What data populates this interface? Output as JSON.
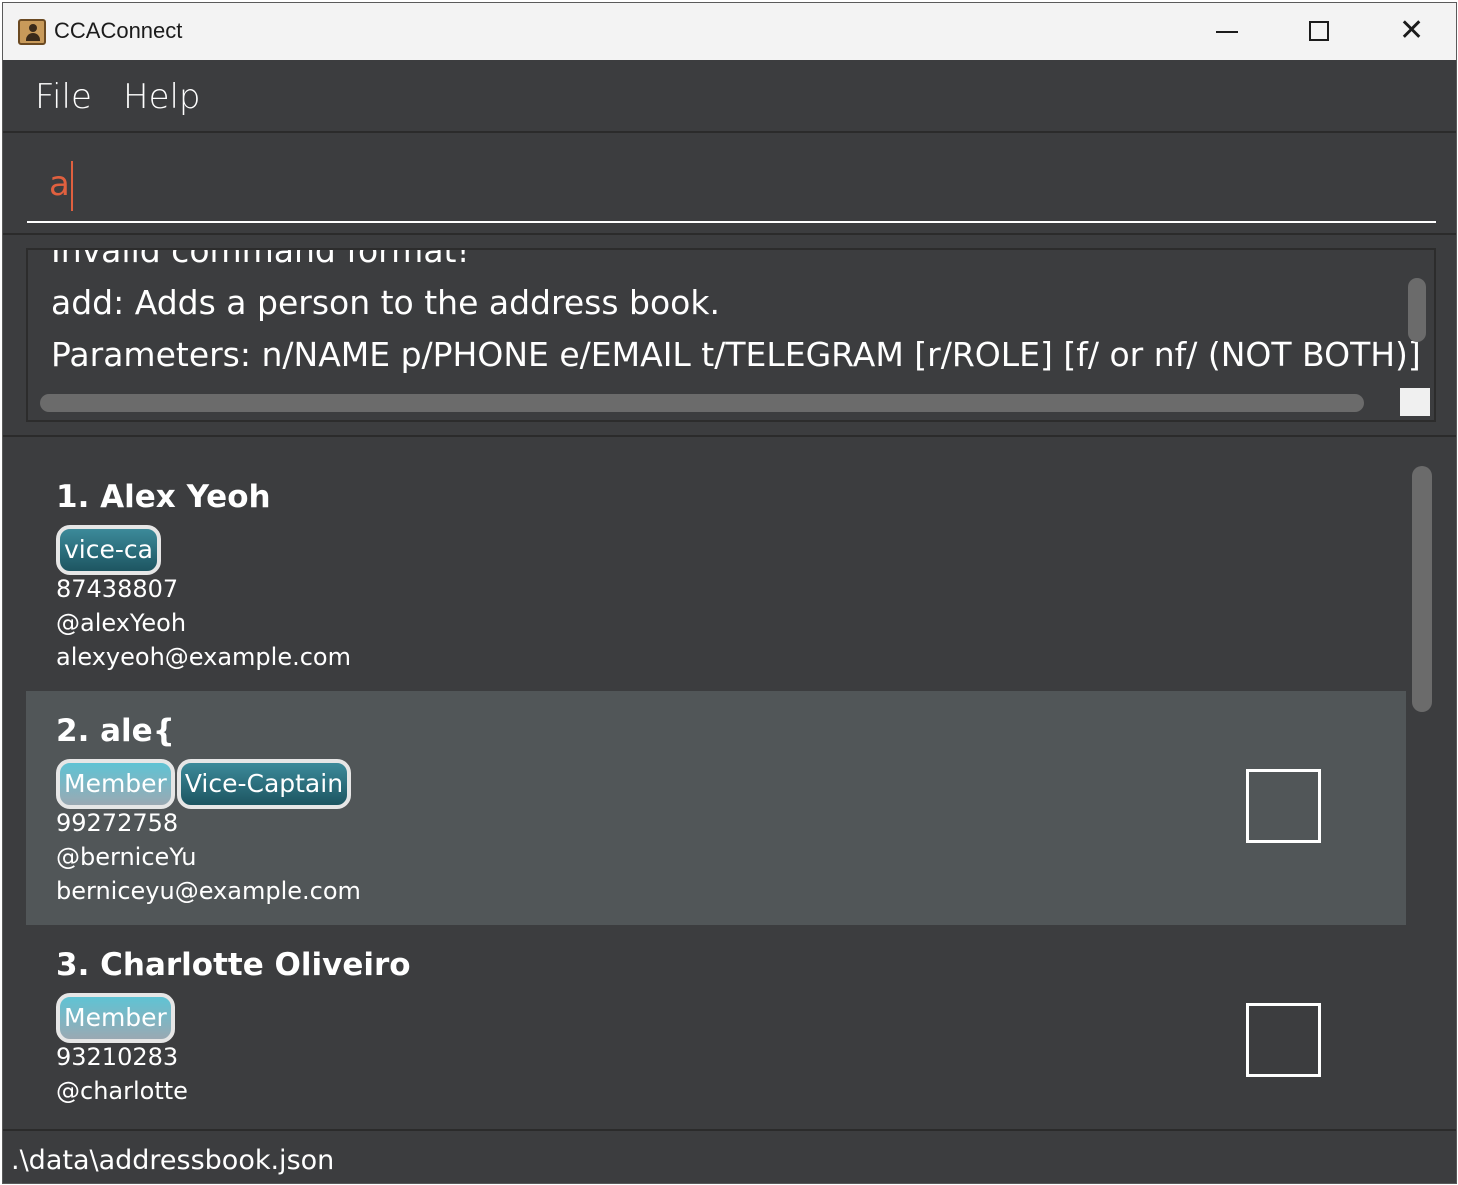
{
  "window": {
    "title": "CCAConnect",
    "icon": "address-book-icon",
    "controls": [
      "minimize",
      "maximize",
      "close"
    ]
  },
  "menu": {
    "file": "File",
    "help": "Help"
  },
  "command": {
    "value": "a"
  },
  "result": {
    "lines": [
      "Invalid command format!",
      "add: Adds a person to the address book.",
      "Parameters: n/NAME p/PHONE e/EMAIL t/TELEGRAM [r/ROLE] [f/ or nf/ (NOT BOTH)]"
    ]
  },
  "persons": [
    {
      "name": "1. Alex Yeoh",
      "tags": [
        {
          "label": "vice-ca",
          "style": "vice"
        }
      ],
      "phone": "87438807",
      "telegram": "@alexYeoh",
      "email": "alexyeoh@example.com",
      "selected": false,
      "checkbox": false
    },
    {
      "name": "2. ale{",
      "tags": [
        {
          "label": "Member",
          "style": "member"
        },
        {
          "label": "Vice-Captain",
          "style": "vice"
        }
      ],
      "phone": "99272758",
      "telegram": "@berniceYu",
      "email": "berniceyu@example.com",
      "selected": true,
      "checkbox": true
    },
    {
      "name": "3. Charlotte Oliveiro",
      "tags": [
        {
          "label": "Member",
          "style": "member"
        }
      ],
      "phone": "93210283",
      "telegram": "@charlotte",
      "email": "",
      "selected": false,
      "checkbox": true
    }
  ],
  "status": {
    "file_path": ".\\data\\addressbook.json"
  },
  "colors": {
    "background": "#3c3d3f",
    "selected_row": "#515658",
    "command_text": "#e0603f",
    "tag_vice": "#2c6f7d",
    "tag_member": "#7ab8c6"
  }
}
